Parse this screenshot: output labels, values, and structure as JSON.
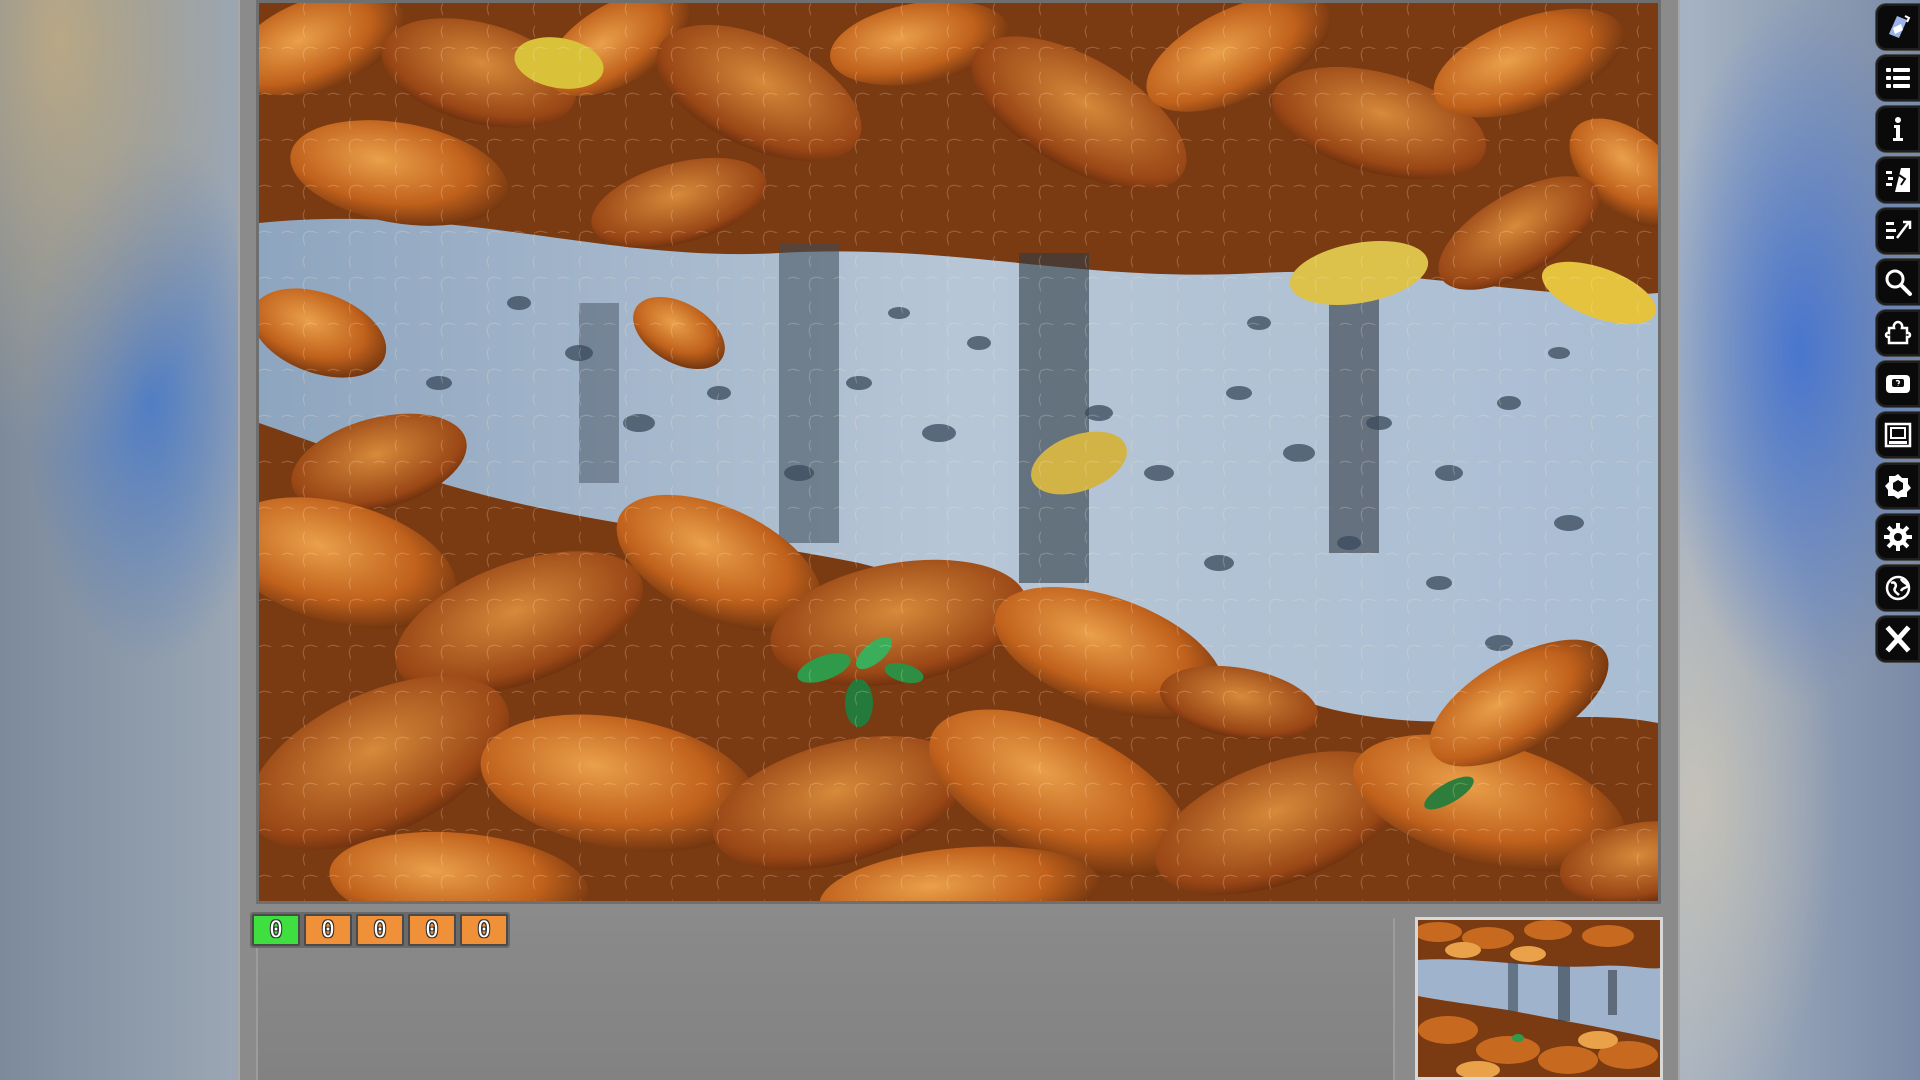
{
  "counters": [
    {
      "value": "0",
      "color": "#3fdf3f"
    },
    {
      "value": "0",
      "color": "#f0913a"
    },
    {
      "value": "0",
      "color": "#f0913a"
    },
    {
      "value": "0",
      "color": "#f0913a"
    },
    {
      "value": "0",
      "color": "#f0913a"
    }
  ],
  "toolbar": [
    {
      "icon": "gallery-icon"
    },
    {
      "icon": "list-icon"
    },
    {
      "icon": "info-icon"
    },
    {
      "icon": "scatter-pieces-icon"
    },
    {
      "icon": "sort-pieces-icon"
    },
    {
      "icon": "magnify-icon"
    },
    {
      "icon": "puzzle-piece-icon"
    },
    {
      "icon": "ghost-image-icon"
    },
    {
      "icon": "screenshot-icon"
    },
    {
      "icon": "shapes-icon"
    },
    {
      "icon": "settings-icon"
    },
    {
      "icon": "web-icon"
    },
    {
      "icon": "close-icon"
    }
  ],
  "puzzle": {
    "theme_colors": {
      "leaf_dark": "#6b2e0c",
      "leaf_orange": "#c7691f",
      "leaf_light": "#e9a14a",
      "water": "#9fb4cc",
      "water_dark": "#3a4a5c"
    }
  }
}
